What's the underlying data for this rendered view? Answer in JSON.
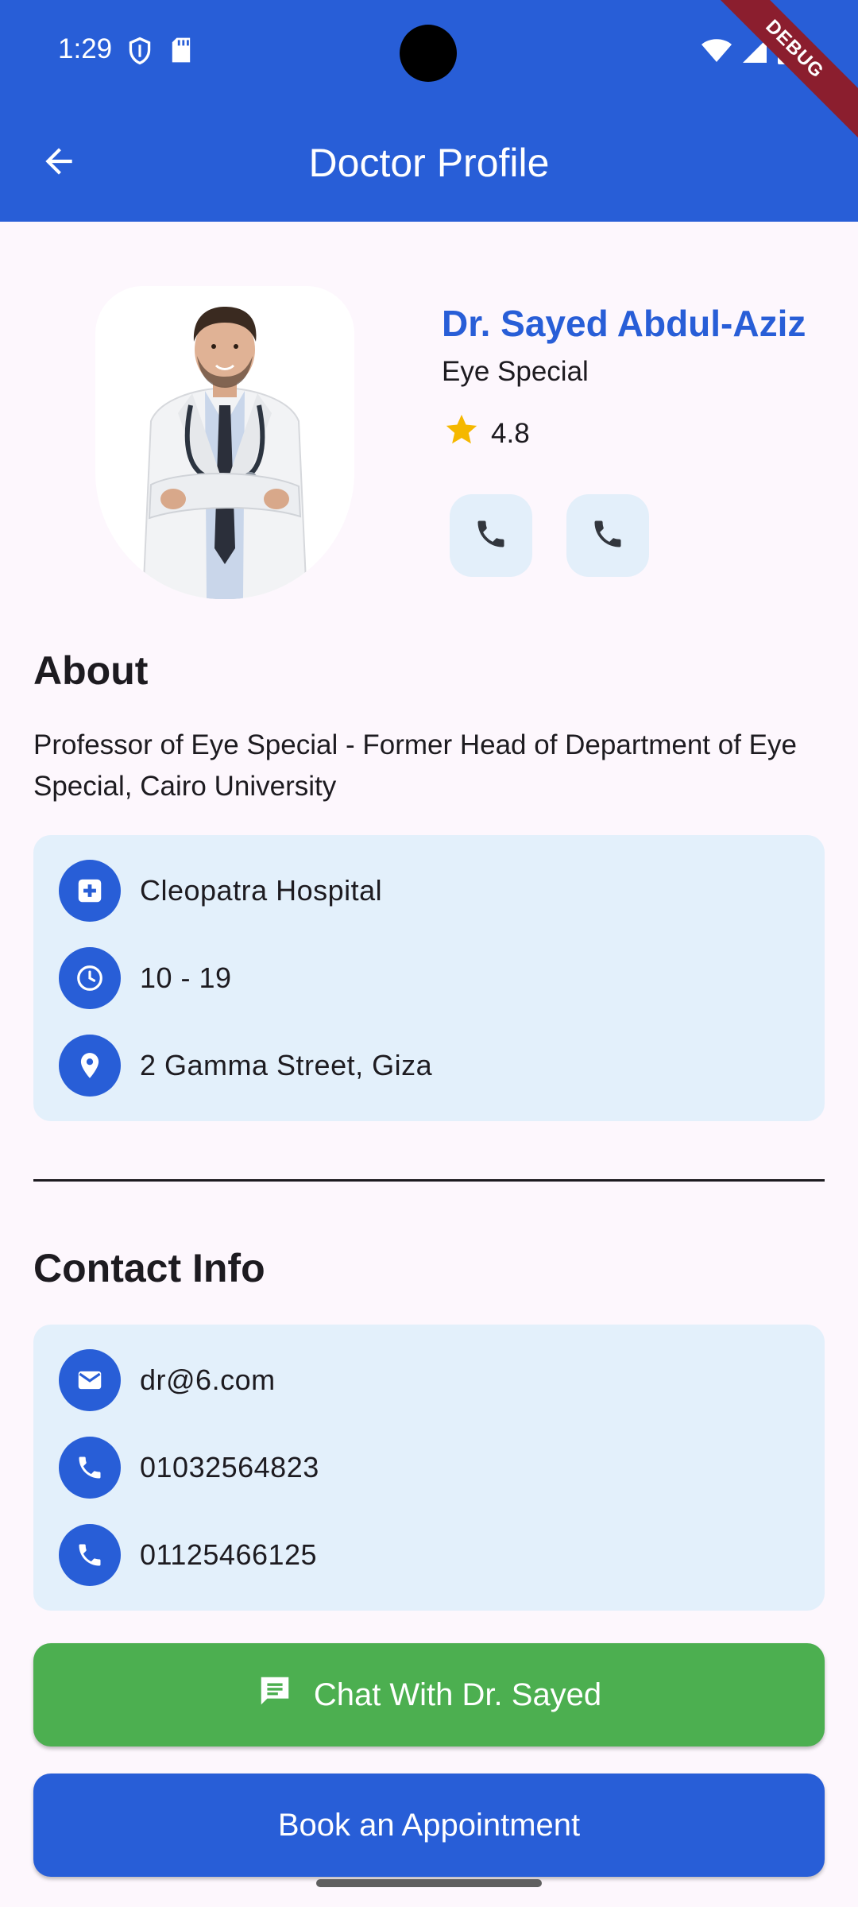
{
  "status_bar": {
    "time": "1:29",
    "icons": [
      "shield-icon",
      "sd-card-icon",
      "wifi-icon",
      "signal-icon",
      "battery-icon"
    ],
    "debug_banner": "DEBUG"
  },
  "app_bar": {
    "title": "Doctor Profile",
    "back_icon": "arrow-back-icon"
  },
  "doctor": {
    "name": "Dr. Sayed Abdul-Aziz",
    "specialty": "Eye Special",
    "rating": "4.8",
    "rating_icon": "star-icon",
    "actions": [
      {
        "icon": "phone-icon"
      },
      {
        "icon": "phone-icon"
      }
    ]
  },
  "about": {
    "title": "About",
    "text": "Professor of Eye Special - Former Head of Department of Eye Special, Cairo University"
  },
  "details": [
    {
      "icon": "hospital-icon",
      "text": "Cleopatra Hospital"
    },
    {
      "icon": "clock-icon",
      "text": "10 - 19"
    },
    {
      "icon": "location-pin-icon",
      "text": "2 Gamma Street, Giza"
    }
  ],
  "contact": {
    "title": "Contact Info",
    "items": [
      {
        "icon": "email-icon",
        "text": "dr@6.com"
      },
      {
        "icon": "phone-icon",
        "text": "01032564823"
      },
      {
        "icon": "phone-icon",
        "text": "01125466125"
      }
    ]
  },
  "buttons": {
    "chat_label": "Chat With Dr. Sayed",
    "chat_icon": "chat-icon",
    "book_label": "Book an Appointment"
  },
  "colors": {
    "primary": "#285ed7",
    "card_bg": "#e3f0fb",
    "chat_green": "#4caf50",
    "star": "#f5b800",
    "background": "#fdf7fd"
  }
}
